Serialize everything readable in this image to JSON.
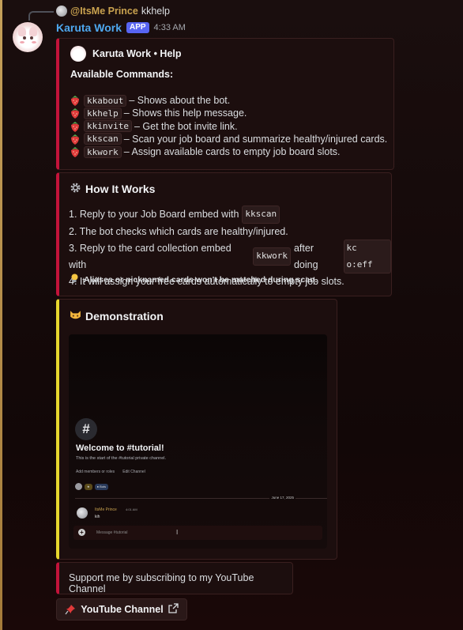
{
  "reply": {
    "username": "@ItsMe Prince",
    "text": "kkhelp"
  },
  "message": {
    "bot_name": "Karuta Work",
    "badge": "APP",
    "time": "4:33 AM"
  },
  "help_embed": {
    "author": "Karuta Work • Help",
    "title": "Available Commands:",
    "commands": [
      {
        "cmd": "kkabout",
        "desc": "– Shows about the bot."
      },
      {
        "cmd": "kkhelp",
        "desc": "– Shows this help message."
      },
      {
        "cmd": "kkinvite",
        "desc": "– Get the bot invite link."
      },
      {
        "cmd": "kkscan",
        "desc": "– Scan your job board and summarize healthy/injured cards."
      },
      {
        "cmd": "kkwork",
        "desc": "– Assign available cards to empty job board slots."
      }
    ],
    "accent_color": "#c3133a"
  },
  "how_embed": {
    "title": "How It Works",
    "steps": {
      "s1_pre": "1. Reply to your Job Board embed with",
      "s1_code": "kkscan",
      "s2": "2. The bot checks which cards are healthy/injured.",
      "s3_pre": "3. Reply to the card collection embed with",
      "s3_code": "kkwork",
      "s3_mid": "after doing",
      "s3_code2": "kc o:eff",
      "s4": "4. It will assign your free cards automatically to empty job slots."
    },
    "note": "Aliases or nicknamed cards won't be matched during scan."
  },
  "demo_embed": {
    "title": "Demonstration",
    "accent_color": "#e6d62e",
    "preview": {
      "welcome": "Welcome to #tutorial!",
      "start": "This is the start of the #tutorial private channel.",
      "add_members": "Add members or roles",
      "edit_channel": "Edit Channel",
      "pill1": "★",
      "pill2": "● Bots",
      "date": "June 17, 2025",
      "msg_name": "ItsMe Prince",
      "msg_time": "4:01 AM",
      "msg_text": "kih",
      "placeholder": "Message #tutorial"
    }
  },
  "support_embed": {
    "text": "Support me by subscribing to my YouTube Channel"
  },
  "button": {
    "label": "YouTube Channel"
  }
}
